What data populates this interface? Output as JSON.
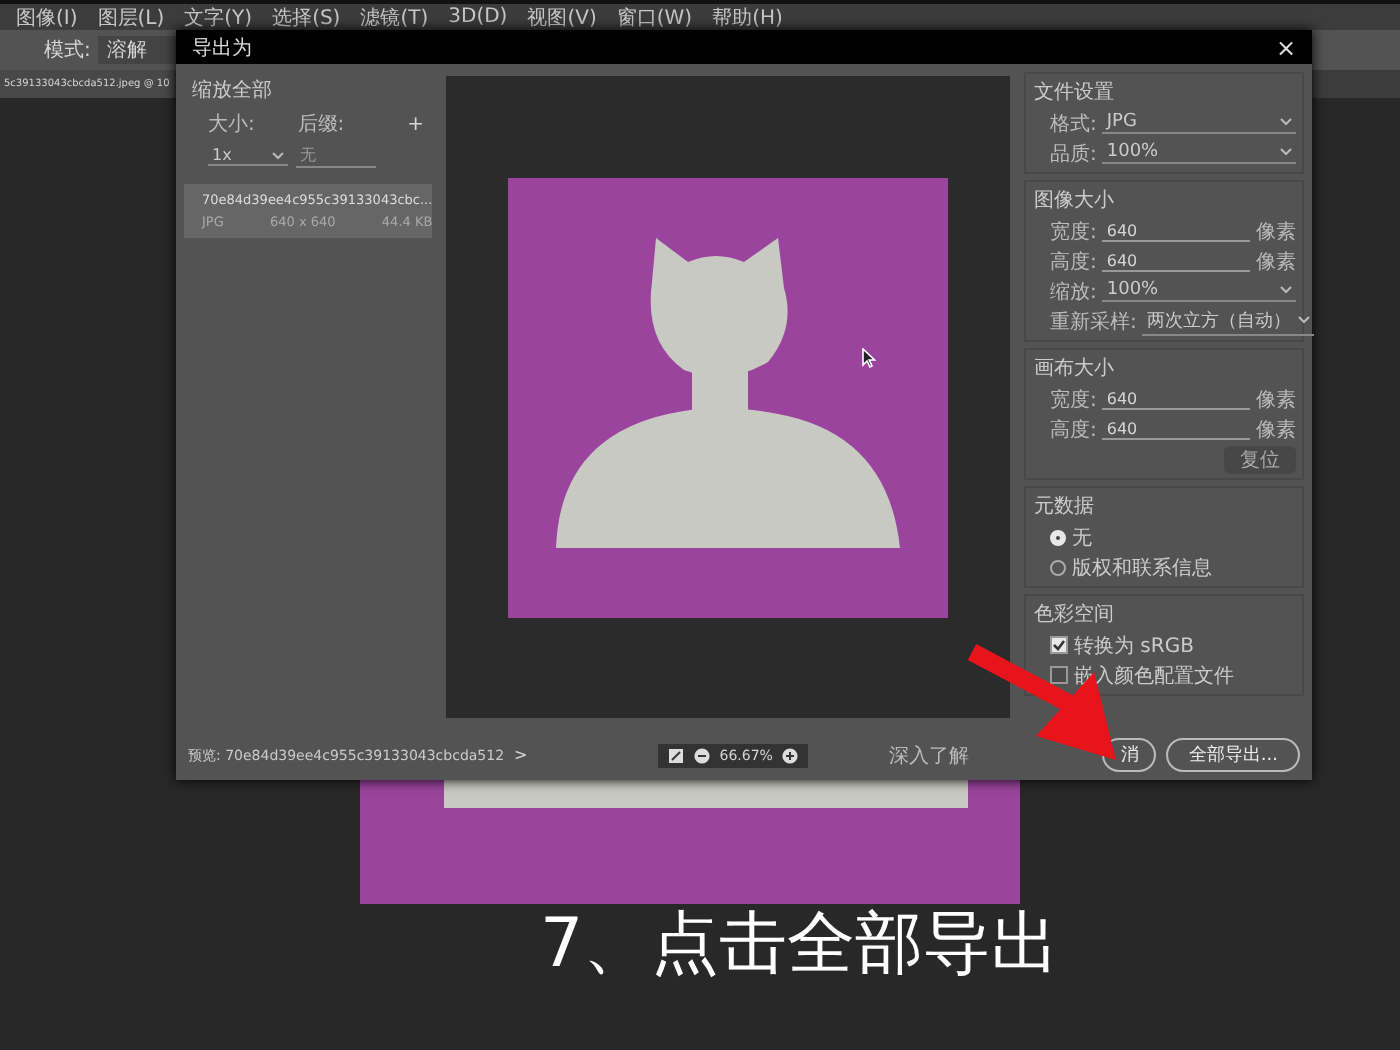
{
  "menu": [
    "图像(I)",
    "图层(L)",
    "文字(Y)",
    "选择(S)",
    "滤镜(T)",
    "3D(D)",
    "视图(V)",
    "窗口(W)",
    "帮助(H)"
  ],
  "options_bar": {
    "mode_label": "模式:",
    "mode_value": "溶解"
  },
  "document_tab": "5c39133043cbcda512.jpeg @ 10",
  "dialog": {
    "title": "导出为",
    "close": "×",
    "scale_all": {
      "heading": "缩放全部",
      "size_label": "大小:",
      "suffix_label": "后缀:",
      "add": "+",
      "size_value": "1x",
      "suffix_placeholder": "无"
    },
    "files": [
      {
        "name": "70e84d39ee4c955c39133043cbc...",
        "format": "JPG",
        "dimensions": "640 x 640",
        "file_size": "44.4 KB",
        "selected": true
      }
    ],
    "settings": [
      {
        "title": "文件设置",
        "rows": [
          {
            "kind": "select",
            "label": "格式:",
            "value": "JPG"
          },
          {
            "kind": "select",
            "label": "品质:",
            "value": "100%"
          }
        ]
      },
      {
        "title": "图像大小",
        "rows": [
          {
            "kind": "field",
            "label": "宽度:",
            "value": "640",
            "unit": "像素"
          },
          {
            "kind": "field",
            "label": "高度:",
            "value": "640",
            "unit": "像素"
          },
          {
            "kind": "select",
            "label": "缩放:",
            "value": "100%"
          },
          {
            "kind": "select",
            "label": "重新采样:",
            "value": "两次立方（自动）"
          }
        ]
      },
      {
        "title": "画布大小",
        "rows": [
          {
            "kind": "field",
            "label": "宽度:",
            "value": "640",
            "unit": "像素"
          },
          {
            "kind": "field",
            "label": "高度:",
            "value": "640",
            "unit": "像素"
          },
          {
            "kind": "button",
            "label": "复位",
            "disabled": true
          }
        ]
      },
      {
        "title": "元数据",
        "rows": [
          {
            "kind": "radio",
            "label": "无",
            "selected": true
          },
          {
            "kind": "radio",
            "label": "版权和联系信息",
            "selected": false
          }
        ]
      },
      {
        "title": "色彩空间",
        "rows": [
          {
            "kind": "checkbox",
            "label": "转换为 sRGB",
            "checked": true
          },
          {
            "kind": "checkbox",
            "label": "嵌入颜色配置文件",
            "checked": false
          }
        ]
      }
    ],
    "footer": {
      "preview": "预览: 70e84d39ee4c955c39133043cbcda512",
      "expand": ">",
      "zoom": "66.67%",
      "learn_more": "深入了解",
      "cancel": "消",
      "export_all": "全部导出..."
    }
  },
  "caption": "7、点击全部导出"
}
